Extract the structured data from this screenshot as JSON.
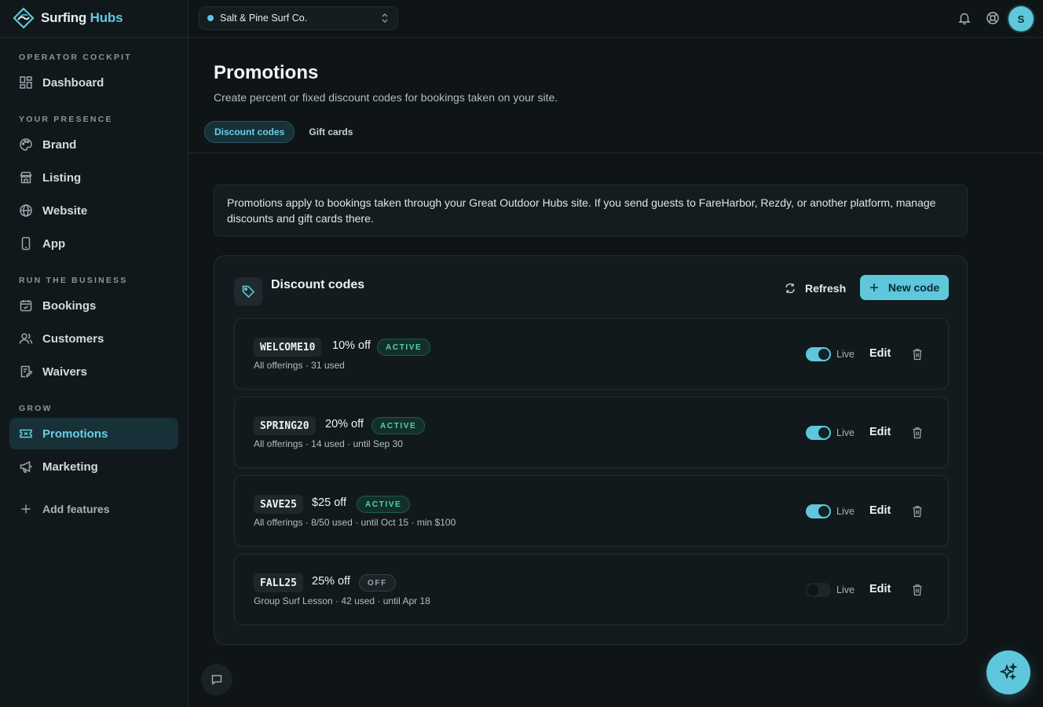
{
  "brand": {
    "name_part1": "Surfing",
    "name_part2": "Hubs"
  },
  "org_select": {
    "value": "Salt & Pine Surf Co."
  },
  "user": {
    "avatar_initial": "S"
  },
  "sidebar": {
    "sections": [
      {
        "title": "OPERATOR COCKPIT"
      },
      {
        "title": "YOUR PRESENCE"
      },
      {
        "title": "RUN THE BUSINESS"
      },
      {
        "title": "GROW"
      }
    ],
    "items": [
      {
        "label": "Dashboard",
        "icon": "dashboard-icon"
      },
      {
        "label": "Brand",
        "icon": "palette-icon"
      },
      {
        "label": "Listing",
        "icon": "store-icon"
      },
      {
        "label": "Website",
        "icon": "globe-icon"
      },
      {
        "label": "App",
        "icon": "phone-icon"
      },
      {
        "label": "Bookings",
        "icon": "calendar-icon"
      },
      {
        "label": "Customers",
        "icon": "users-icon"
      },
      {
        "label": "Waivers",
        "icon": "document-sign-icon"
      },
      {
        "label": "Promotions",
        "icon": "ticket-icon",
        "active": true
      },
      {
        "label": "Marketing",
        "icon": "megaphone-icon"
      }
    ],
    "add_features": "Add features"
  },
  "page": {
    "title": "Promotions",
    "subtitle": "Create percent or fixed discount codes for bookings taken on your site.",
    "tabs": [
      {
        "label": "Discount codes",
        "active": true
      },
      {
        "label": "Gift cards",
        "active": false
      }
    ],
    "notice": "Promotions apply to bookings taken through your Great Outdoor Hubs site. If you send guests to FareHarbor, Rezdy, or another platform, manage discounts and gift cards there."
  },
  "card": {
    "title": "Discount codes",
    "refresh_label": "Refresh",
    "new_label": "New code"
  },
  "codes": [
    {
      "code": "WELCOME10",
      "discount": "10% off",
      "status": "ACTIVE",
      "meta": "All offerings · 31 used",
      "live": true,
      "live_label": "Live",
      "edit_label": "Edit"
    },
    {
      "code": "SPRING20",
      "discount": "20% off",
      "status": "ACTIVE",
      "meta": "All offerings · 14 used · until Sep 30",
      "live": true,
      "live_label": "Live",
      "edit_label": "Edit"
    },
    {
      "code": "SAVE25",
      "discount": "$25 off",
      "status": "ACTIVE",
      "meta": "All offerings · 8/50 used · until Oct 15 · min $100",
      "live": true,
      "live_label": "Live",
      "edit_label": "Edit"
    },
    {
      "code": "FALL25",
      "discount": "25% off",
      "status": "OFF",
      "meta": "Group Surf Lesson · 42 used · until Apr 18",
      "live": false,
      "live_label": "Live",
      "edit_label": "Edit"
    }
  ],
  "colors": {
    "accent": "#5ec7dc",
    "active_badge": "#58d2a6"
  }
}
